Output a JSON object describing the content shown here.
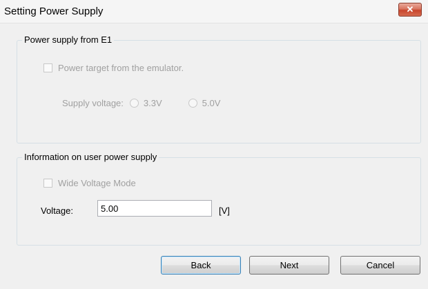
{
  "window": {
    "title": "Setting Power Supply",
    "close_glyph": "✕"
  },
  "group_e1": {
    "legend": "Power supply from E1",
    "power_target_label": "Power target from the emulator.",
    "supply_voltage_label": "Supply voltage:",
    "options": [
      "3.3V",
      "5.0V"
    ],
    "enabled": false
  },
  "group_user": {
    "legend": "Information on user power supply",
    "wide_voltage_label": "Wide Voltage Mode",
    "voltage_label": "Voltage:",
    "voltage_value": "5.00",
    "unit": "[V]"
  },
  "buttons": {
    "back": "Back",
    "next": "Next",
    "cancel": "Cancel"
  },
  "colors": {
    "close_red": "#c8452c",
    "disabled_text": "#a0a0a0",
    "group_border": "#d5dfe5"
  }
}
